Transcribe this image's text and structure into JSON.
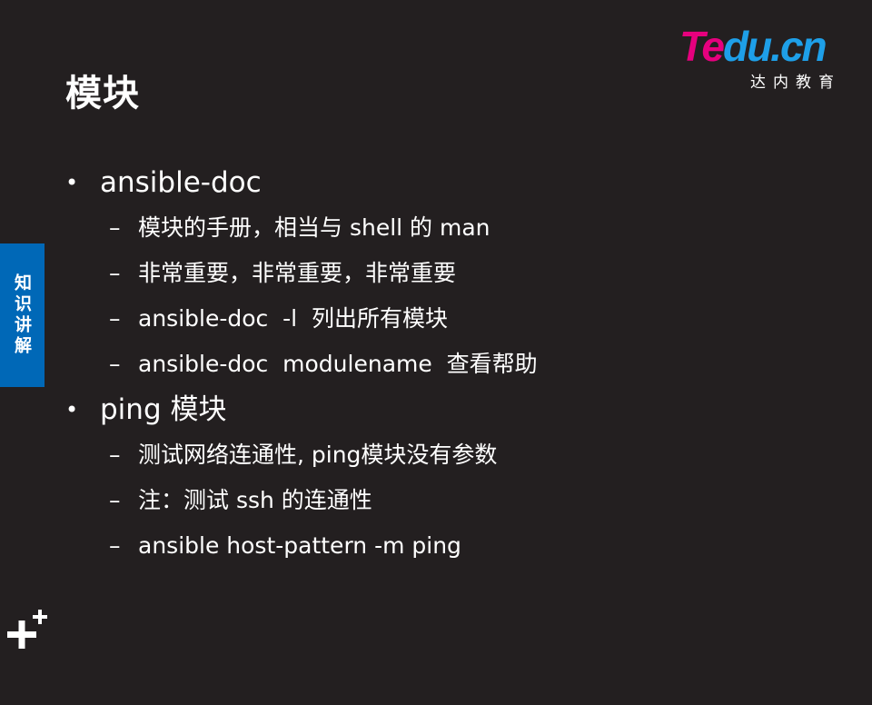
{
  "slide": {
    "title": "模块",
    "side_tab": "知识讲解",
    "logo": {
      "brand_part1": "Te",
      "brand_part2": "du.cn",
      "subtitle": "达内教育"
    },
    "items": [
      {
        "text": "ansible-doc",
        "children": [
          "模块的手册，相当与 shell 的 man",
          "非常重要，非常重要，非常重要",
          "ansible-doc  -l  列出所有模块",
          "ansible-doc  modulename  查看帮助"
        ]
      },
      {
        "text": "ping 模块",
        "children": [
          "测试网络连通性, ping模块没有参数",
          "注：测试 ssh 的连通性",
          "ansible host-pattern -m ping"
        ]
      }
    ],
    "bullet_char": "•",
    "dash_char": "–",
    "colors": {
      "background": "#231f20",
      "side_tab": "#0068b7",
      "logo_pink": "#e6007e",
      "logo_blue": "#1e9fe8",
      "text": "#ffffff"
    }
  }
}
